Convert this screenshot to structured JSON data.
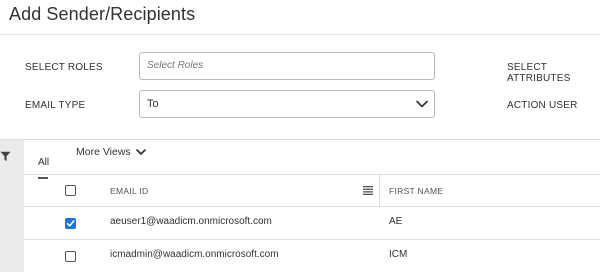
{
  "header": {
    "title": "Add Sender/Recipients"
  },
  "form": {
    "select_roles_label": "SELECT ROLES",
    "select_roles_placeholder": "Select Roles",
    "select_attributes_label": "SELECT ATTRIBUTES",
    "email_type_label": "EMAIL TYPE",
    "email_type_value": "To",
    "action_user_label": "ACTION USER"
  },
  "views": {
    "tab_all": "All",
    "more_views": "More Views"
  },
  "grid": {
    "columns": [
      {
        "label": "EMAIL ID"
      },
      {
        "label": "FIRST NAME"
      }
    ],
    "rows": [
      {
        "email": "aeuser1@waadicm.onmicrosoft.com",
        "first_name": "AE",
        "checked": true
      },
      {
        "email": "icmadmin@waadicm.onmicrosoft.com",
        "first_name": "ICM",
        "checked": false
      }
    ]
  },
  "icons": {
    "filter": "filter-icon",
    "chevron": "chevron-down-icon",
    "column_menu": "column-menu-icon",
    "check": "check-icon"
  },
  "colors": {
    "accent": "#1a73e8",
    "rail": "#ebebeb"
  }
}
